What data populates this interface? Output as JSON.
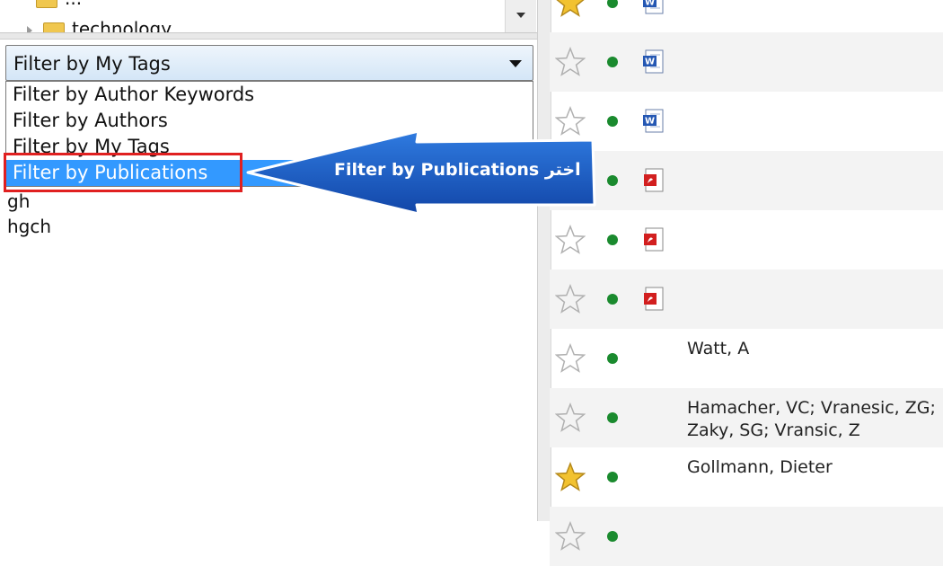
{
  "tree": {
    "items": [
      {
        "label": "..."
      },
      {
        "label": "technology"
      }
    ]
  },
  "filter": {
    "selected": "Filter by My Tags",
    "options": [
      "Filter by Author Keywords",
      "Filter by Authors",
      "Filter by My Tags",
      "Filter by Publications"
    ],
    "highlighted_index": 3,
    "tags": [
      "gh",
      "hgch"
    ]
  },
  "callout": {
    "text": "Filter by Publications اختر",
    "color": "#1f5fc7"
  },
  "documents": [
    {
      "starred": true,
      "status": "green",
      "icon": "word-icon",
      "author": ""
    },
    {
      "starred": false,
      "status": "green",
      "icon": "word-icon",
      "author": ""
    },
    {
      "starred": false,
      "status": "green",
      "icon": "word-icon",
      "author": ""
    },
    {
      "starred": false,
      "status": "green",
      "icon": "pdf-icon",
      "author": ""
    },
    {
      "starred": false,
      "status": "green",
      "icon": "pdf-icon",
      "author": ""
    },
    {
      "starred": false,
      "status": "green",
      "icon": "pdf-icon",
      "author": ""
    },
    {
      "starred": false,
      "status": "green",
      "icon": "",
      "author": "Watt, A"
    },
    {
      "starred": false,
      "status": "green",
      "icon": "",
      "author": "Hamacher, VC; Vranesic, ZG; Zaky, SG; Vransic, Z"
    },
    {
      "starred": true,
      "status": "green",
      "icon": "",
      "author": "Gollmann, Dieter"
    },
    {
      "starred": false,
      "status": "green",
      "icon": "",
      "author": ""
    }
  ],
  "colors": {
    "highlight": "#3399ff",
    "callout_border": "#e02020",
    "status_dot": "#1a8a2e",
    "star_gold": "#f2c230"
  }
}
